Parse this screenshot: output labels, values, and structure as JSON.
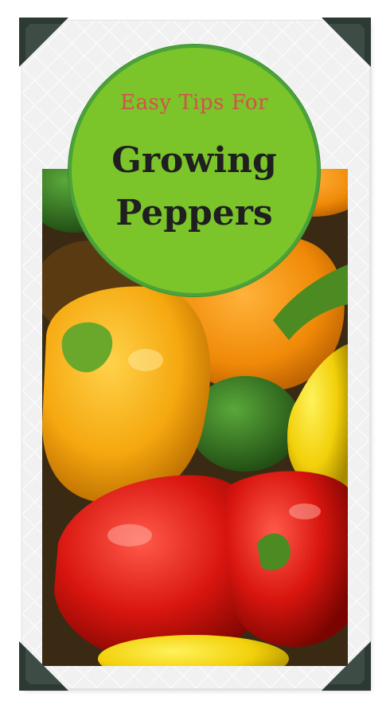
{
  "badge": {
    "subtitle": "Easy Tips For",
    "title_line1": "Growing",
    "title_line2": "Peppers"
  },
  "colors": {
    "badge_fill": "#7bc42a",
    "badge_ring": "#4aa23a",
    "subtitle_color": "#d2524e",
    "title_color": "#1f1f1f",
    "corner_color": "#2d3a33"
  },
  "icons": [
    "photo-corner-icon"
  ],
  "image": {
    "subject": "bell peppers"
  }
}
